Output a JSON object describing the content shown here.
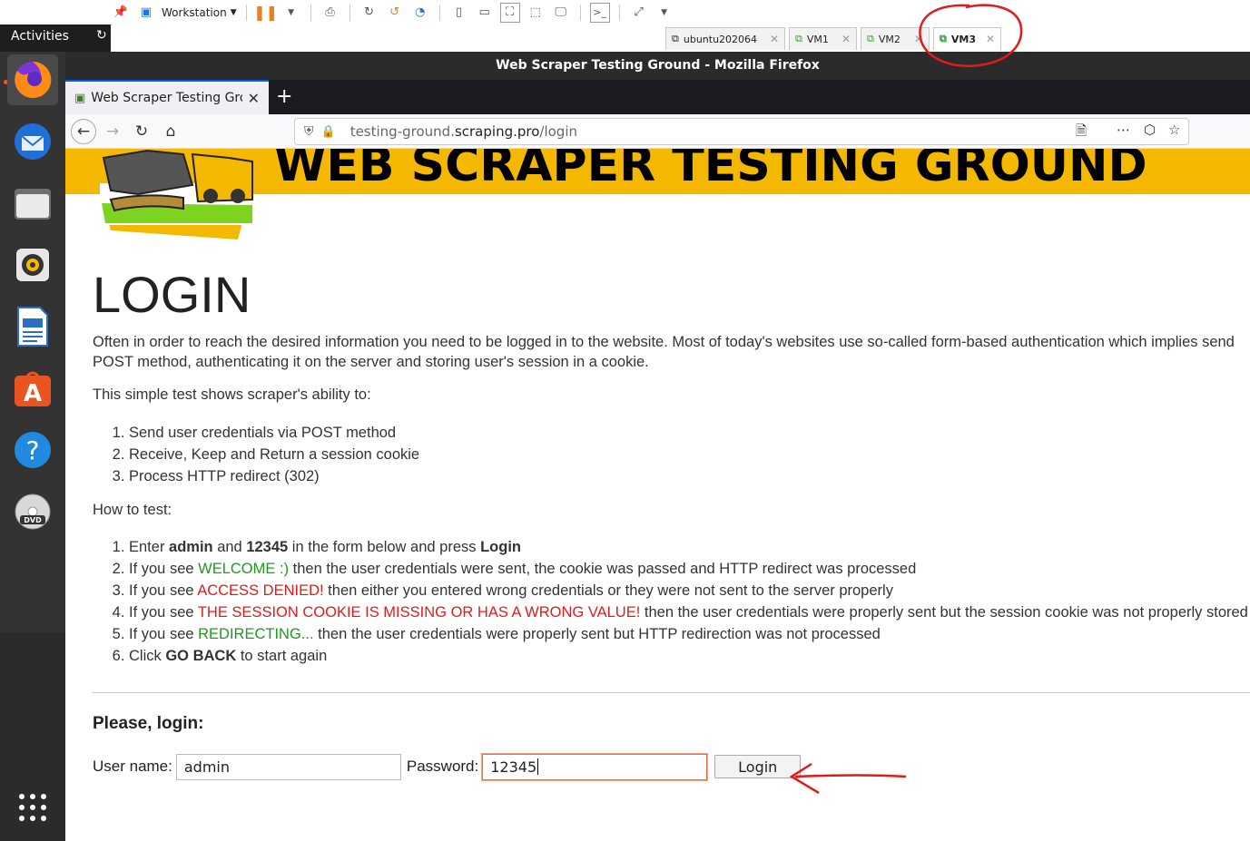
{
  "vm_toolbar": {
    "workstation_label": "Workstation",
    "tabs": [
      {
        "label": "ubuntu202064"
      },
      {
        "label": "VM1"
      },
      {
        "label": "VM2"
      },
      {
        "label": "VM3"
      }
    ]
  },
  "ubuntu": {
    "activities_label": "Activities"
  },
  "dock": {
    "items": [
      "firefox-icon",
      "thunderbird-icon",
      "files-icon",
      "rhythmbox-icon",
      "libreoffice-writer-icon",
      "app-center-icon",
      "help-icon",
      "dvd-icon",
      "show-apps-icon"
    ]
  },
  "firefox": {
    "window_title": "Web Scraper Testing Ground - Mozilla Firefox",
    "tab_title": "Web Scraper Testing Ground",
    "url_host": "testing-ground.",
    "url_domain": "scraping.pro",
    "url_path": "/login"
  },
  "page": {
    "banner_title": "WEB SCRAPER TESTING GROUND",
    "heading": "LOGIN",
    "intro_line1": "Often in order to reach the desired information you need to be logged in to the website. Most of today's websites use so-called form-based authentication which implies send",
    "intro_line2": "POST method, authenticating it on the server and storing user's session in a cookie.",
    "simple_test": "This simple test shows scraper's ability to:",
    "abilities": [
      "Send user credentials via POST method",
      "Receive, Keep and Return a session cookie",
      "Process HTTP redirect (302)"
    ],
    "how_to_test": "How to test:",
    "steps": {
      "s1_pre": "Enter ",
      "s1_user": "admin",
      "s1_and": " and ",
      "s1_pass": "12345",
      "s1_mid": " in the form below and press ",
      "s1_login": "Login",
      "s2_pre": "If you see ",
      "s2_hl": "WELCOME :)",
      "s2_post": " then the user credentials were sent, the cookie was passed and HTTP redirect was processed",
      "s3_pre": "If you see ",
      "s3_hl": "ACCESS DENIED!",
      "s3_post": " then either you entered wrong credentials or they were not sent to the server properly",
      "s4_pre": "If you see ",
      "s4_hl": "THE SESSION COOKIE IS MISSING OR HAS A WRONG VALUE!",
      "s4_post": " then the user credentials were properly sent but the session cookie was not properly stored or pa",
      "s5_pre": "If you see ",
      "s5_hl": "REDIRECTING...",
      "s5_post": " then the user credentials were properly sent but HTTP redirection was not processed",
      "s6_pre": "Click ",
      "s6_hl": "GO BACK",
      "s6_post": " to start again"
    },
    "form": {
      "heading": "Please, login:",
      "username_label": "User name:",
      "username_value": "admin",
      "password_label": "Password:",
      "password_value": "12345",
      "login_button": "Login"
    }
  },
  "colors": {
    "banner": "#f5b800",
    "success_green": "#1f9a1f",
    "error_red": "#e01b1b",
    "annotation_red": "#e01b1b"
  }
}
